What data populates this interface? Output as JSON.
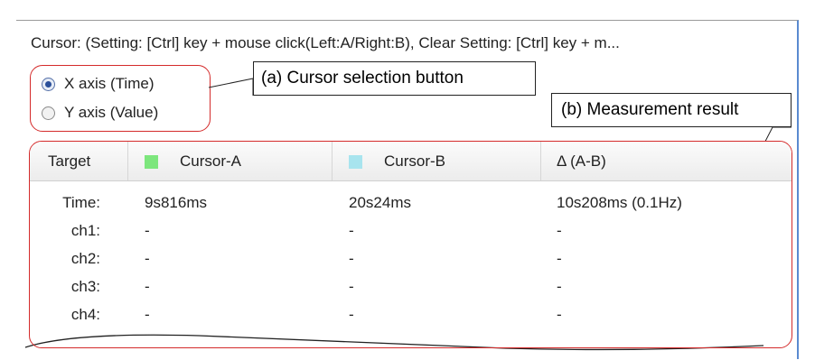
{
  "hint_text": "Cursor: (Setting: [Ctrl] key + mouse click(Left:A/Right:B), Clear Setting: [Ctrl] key + m...",
  "radio": {
    "x_axis_label": "X axis (Time)",
    "y_axis_label": "Y axis (Value)",
    "selected": "x_axis"
  },
  "callouts": {
    "a": "(a)  Cursor selection button",
    "b": "(b)  Measurement result"
  },
  "table": {
    "headers": {
      "target": "Target",
      "cursor_a": "Cursor-A",
      "cursor_b": "Cursor-B",
      "delta": "Δ (A-B)"
    },
    "colors": {
      "cursor_a": "#7de67d",
      "cursor_b": "#a8e4ee",
      "annotation": "#d42a2a"
    },
    "rows": [
      {
        "label": "Time:",
        "a": "9s816ms",
        "b": "20s24ms",
        "delta": "10s208ms (0.1Hz)"
      },
      {
        "label": "ch1:",
        "a": "-",
        "b": "-",
        "delta": "-"
      },
      {
        "label": "ch2:",
        "a": "-",
        "b": "-",
        "delta": "-"
      },
      {
        "label": "ch3:",
        "a": "-",
        "b": "-",
        "delta": "-"
      },
      {
        "label": "ch4:",
        "a": "-",
        "b": "-",
        "delta": "-"
      }
    ]
  }
}
